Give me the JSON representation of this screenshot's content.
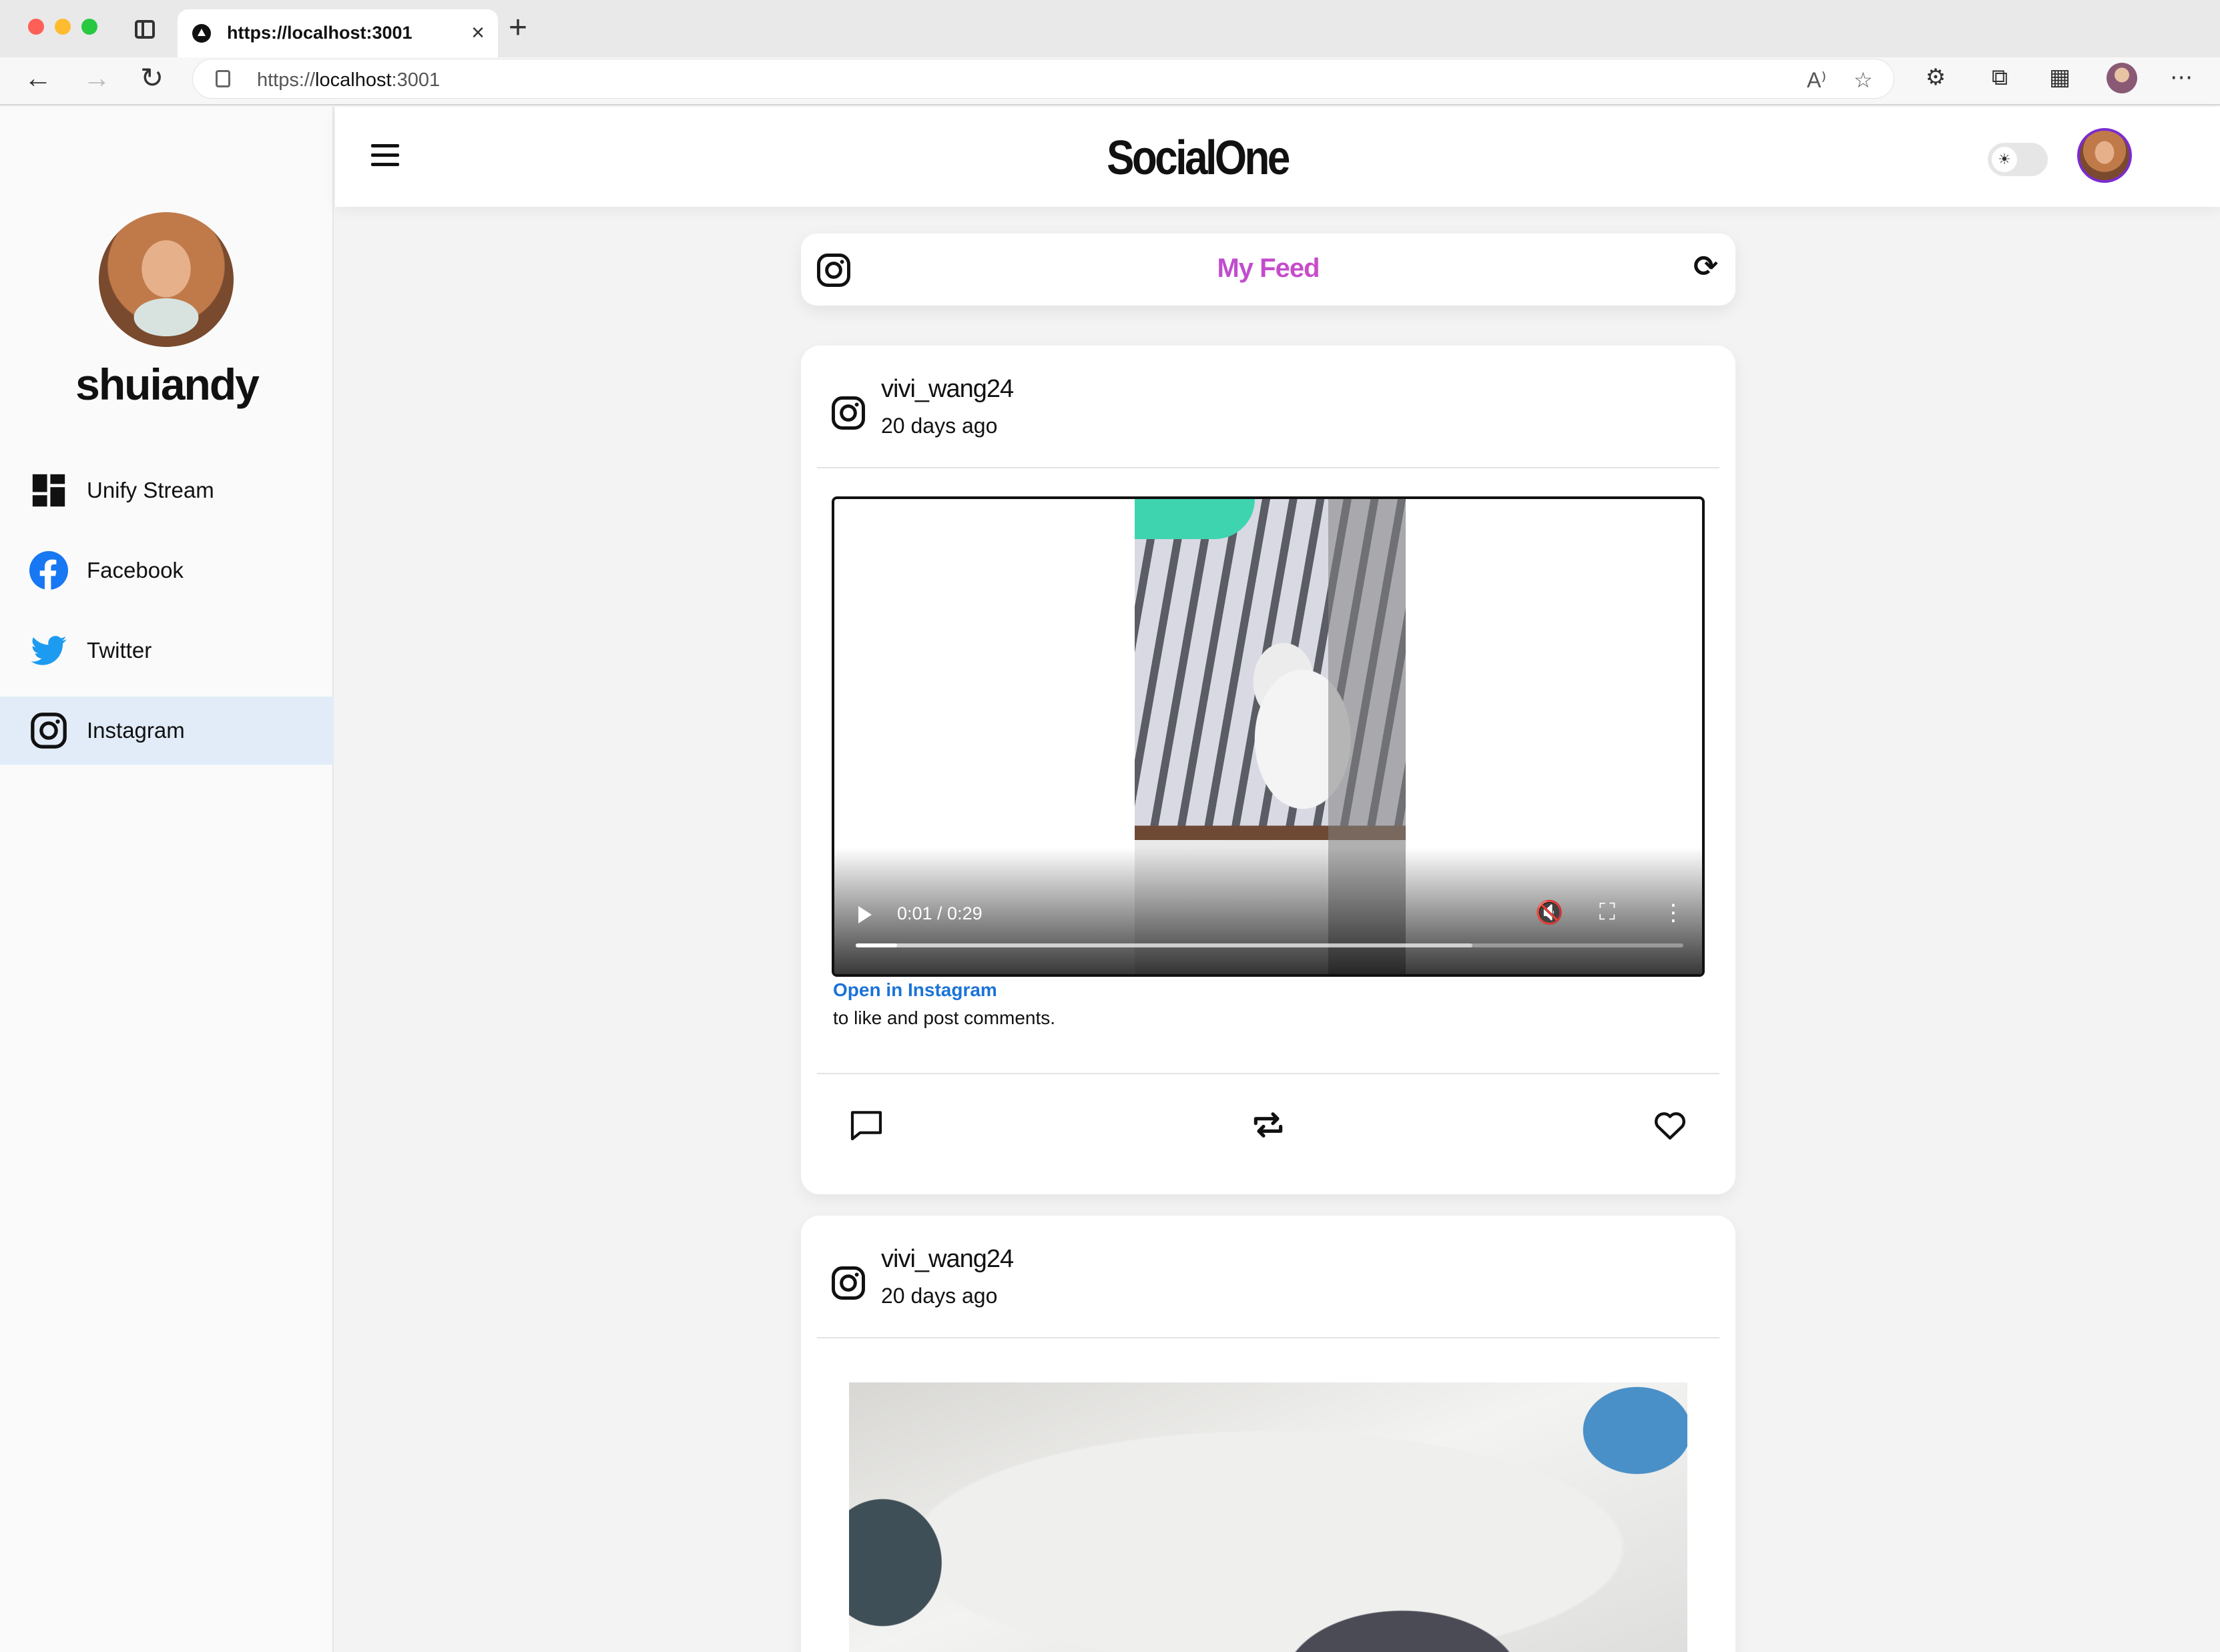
{
  "browser": {
    "tab_title": "https://localhost:3001",
    "url_scheme": "https://",
    "url_host": "localhost",
    "url_port": ":3001",
    "tab_close": "×",
    "new_tab": "+"
  },
  "sidebar": {
    "username": "shuiandy",
    "items": [
      {
        "label": "Unify Stream",
        "icon": "dashboard-icon",
        "active": false
      },
      {
        "label": "Facebook",
        "icon": "facebook-icon",
        "active": false
      },
      {
        "label": "Twitter",
        "icon": "twitter-icon",
        "active": false
      },
      {
        "label": "Instagram",
        "icon": "instagram-icon",
        "active": true
      }
    ]
  },
  "header": {
    "logo": "SocialOne",
    "theme_icon": "☀"
  },
  "feed": {
    "title": "My Feed",
    "refresh_icon": "⟳"
  },
  "posts": [
    {
      "username": "vivi_wang24",
      "time": "20 days ago",
      "media": "video",
      "video": {
        "current_time": "0:01",
        "duration": "0:29",
        "time_display": "0:01 / 0:29",
        "progress_fraction": 0.05,
        "buffered_fraction": 0.745
      },
      "open_link": "Open in Instagram",
      "open_desc": "to like and post comments."
    },
    {
      "username": "vivi_wang24",
      "time": "20 days ago",
      "media": "image"
    }
  ],
  "colors": {
    "accent_link": "#1a73d8",
    "active_sidebar": "#e1ecf8",
    "feed_title_gradient_start": "#9b4ee6",
    "feed_title_gradient_end": "#ec4bb3",
    "facebook_blue": "#1877f2",
    "twitter_blue": "#1d9bf0",
    "avatar_ring": "#7b2ccf"
  }
}
